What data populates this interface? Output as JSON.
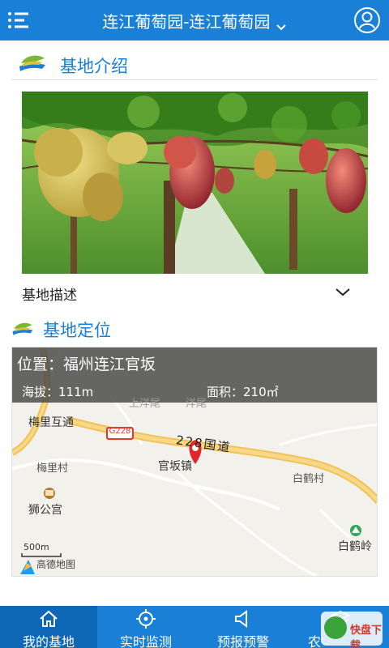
{
  "header": {
    "title": "连江葡萄园-连江葡萄园",
    "menu_icon": "menu-icon",
    "user_icon": "user-icon"
  },
  "intro": {
    "title": "基地介绍",
    "description_label": "基地描述"
  },
  "location": {
    "title": "基地定位",
    "position_text": "位置：福州连江官坂",
    "altitude_text": "海拔：111m",
    "area_text": "面积：210㎡"
  },
  "map": {
    "labels": {
      "interchange": "梅里互通",
      "village_meili": "梅里村",
      "shigong": "狮公宫",
      "guanban": "官坂镇",
      "baihe_village": "白鹤村",
      "baihe_ling": "白鹤岭",
      "road_g228": "G228",
      "road_name": "228国道",
      "faded_1": "上洋尾",
      "faded_2": "洋尾"
    },
    "scale": "500m",
    "provider": "高德地图"
  },
  "nav": {
    "items": [
      {
        "label": "我的基地",
        "icon": "home-icon",
        "active": true
      },
      {
        "label": "实时监测",
        "icon": "target-icon",
        "active": false
      },
      {
        "label": "预报预警",
        "icon": "speaker-icon",
        "active": false
      },
      {
        "label": "农",
        "icon": "layers-icon",
        "active": false
      }
    ]
  },
  "watermark": {
    "text": "快盘下载"
  },
  "colors": {
    "brand": "#1a7fd6",
    "section_title": "#1a7fd6",
    "road": "#f2c257",
    "marker": "#e0262b"
  }
}
